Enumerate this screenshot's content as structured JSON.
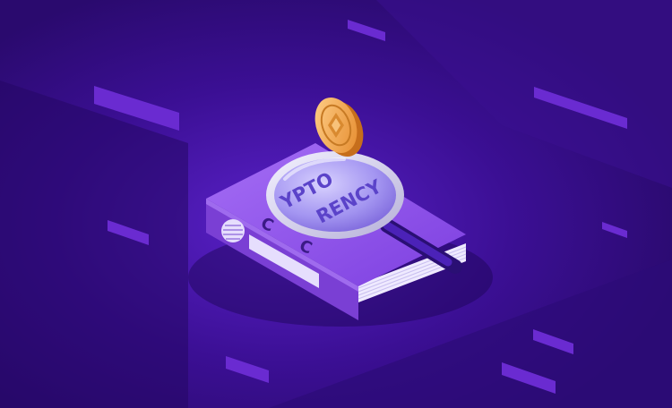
{
  "illustration": {
    "lens_text_line1": "YPTO",
    "lens_text_line2": "RENCY",
    "cover_letter_top": "C",
    "cover_letter_bottom": "C"
  },
  "colors": {
    "background": "#2a0a6e",
    "book_cover": "#9353e8",
    "book_spine": "#7a3fd4",
    "coin": "#f4a94a",
    "lens": "#b9a8ff"
  }
}
